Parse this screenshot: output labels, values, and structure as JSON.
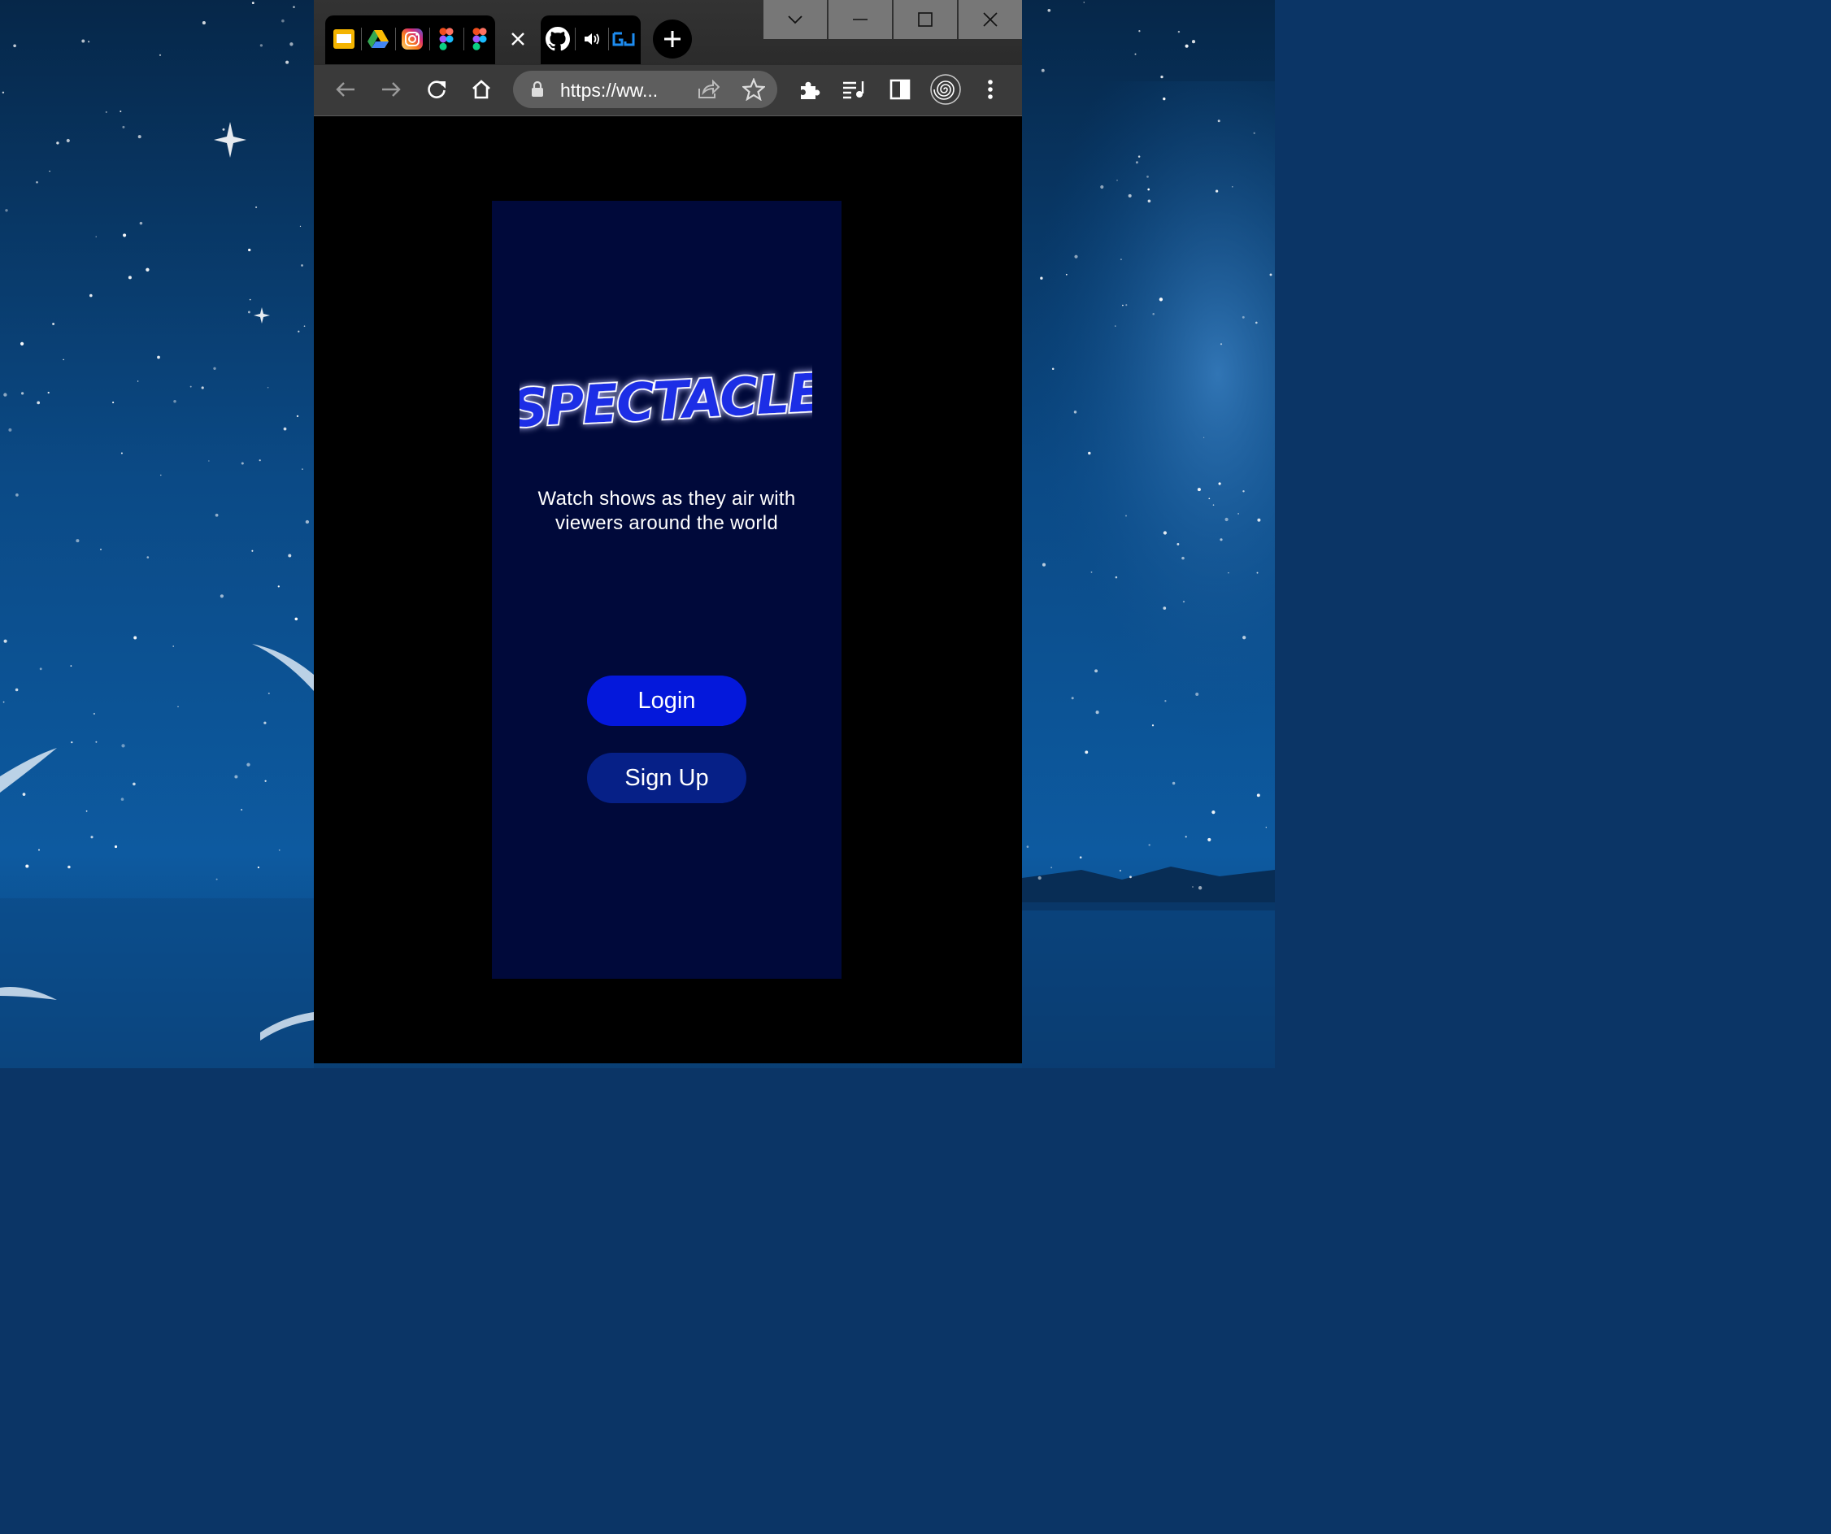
{
  "browser": {
    "tabs": [
      {
        "icon": "google-slides-icon"
      },
      {
        "icon": "google-drive-icon"
      },
      {
        "icon": "instagram-icon"
      },
      {
        "icon": "figma-icon"
      },
      {
        "icon": "figma-icon"
      },
      {
        "icon": "close-icon"
      },
      {
        "icon": "github-icon"
      },
      {
        "icon": "speaker-icon"
      },
      {
        "icon": "gj-app-icon"
      },
      {
        "icon": "new-tab-plus-icon"
      }
    ],
    "url": "https://ww...",
    "window_controls": [
      "tab-search-chevron",
      "minimize",
      "maximize",
      "close"
    ]
  },
  "app": {
    "logo_text": "SPECTACLE",
    "tagline_line1": "Watch shows as they air with",
    "tagline_line2": "viewers around the world",
    "login_label": "Login",
    "signup_label": "Sign Up",
    "colors": {
      "screen_bg": "#00093a",
      "login_bg": "#0418db",
      "signup_bg": "#062087",
      "logo_fill": "#1a2ee6"
    }
  }
}
